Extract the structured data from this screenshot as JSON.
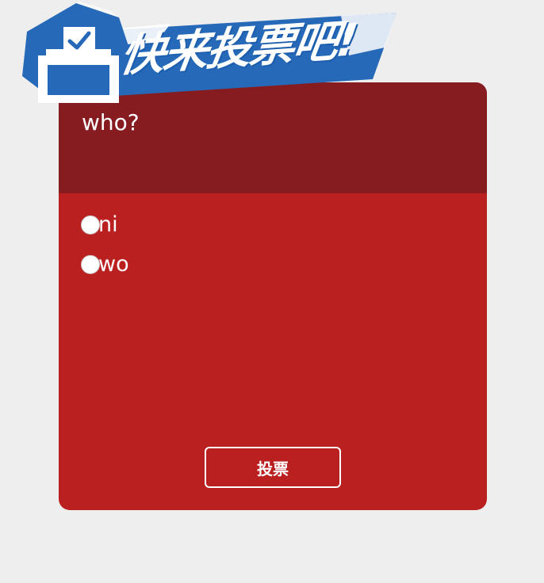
{
  "banner": {
    "title": "快来投票吧!",
    "icon": "ballot-box-icon",
    "color": "#2569b8"
  },
  "poll": {
    "question": "who?",
    "options": [
      {
        "label": "ni"
      },
      {
        "label": "wo"
      }
    ],
    "vote_label": "投票"
  },
  "colors": {
    "background": "#eeeeee",
    "header": "#861b20",
    "body": "#bb2020"
  }
}
